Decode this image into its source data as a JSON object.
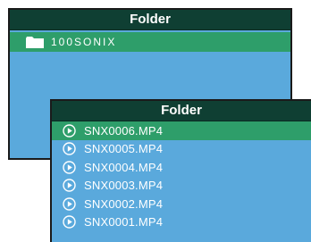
{
  "back_panel": {
    "title": "Folder",
    "items": [
      {
        "label": "100SONIX",
        "icon": "folder-icon",
        "selected": true
      }
    ]
  },
  "front_panel": {
    "title": "Folder",
    "items": [
      {
        "label": "SNX0006.MP4",
        "icon": "play-icon",
        "selected": true
      },
      {
        "label": "SNX0005.MP4",
        "icon": "play-icon",
        "selected": false
      },
      {
        "label": "SNX0004.MP4",
        "icon": "play-icon",
        "selected": false
      },
      {
        "label": "SNX0003.MP4",
        "icon": "play-icon",
        "selected": false
      },
      {
        "label": "SNX0002.MP4",
        "icon": "play-icon",
        "selected": false
      },
      {
        "label": "SNX0001.MP4",
        "icon": "play-icon",
        "selected": false
      }
    ]
  },
  "colors": {
    "titlebar": "#0f3f33",
    "panel_bg": "#5aa9dc",
    "selected_row": "#2e9e6a",
    "text": "#ffffff"
  }
}
